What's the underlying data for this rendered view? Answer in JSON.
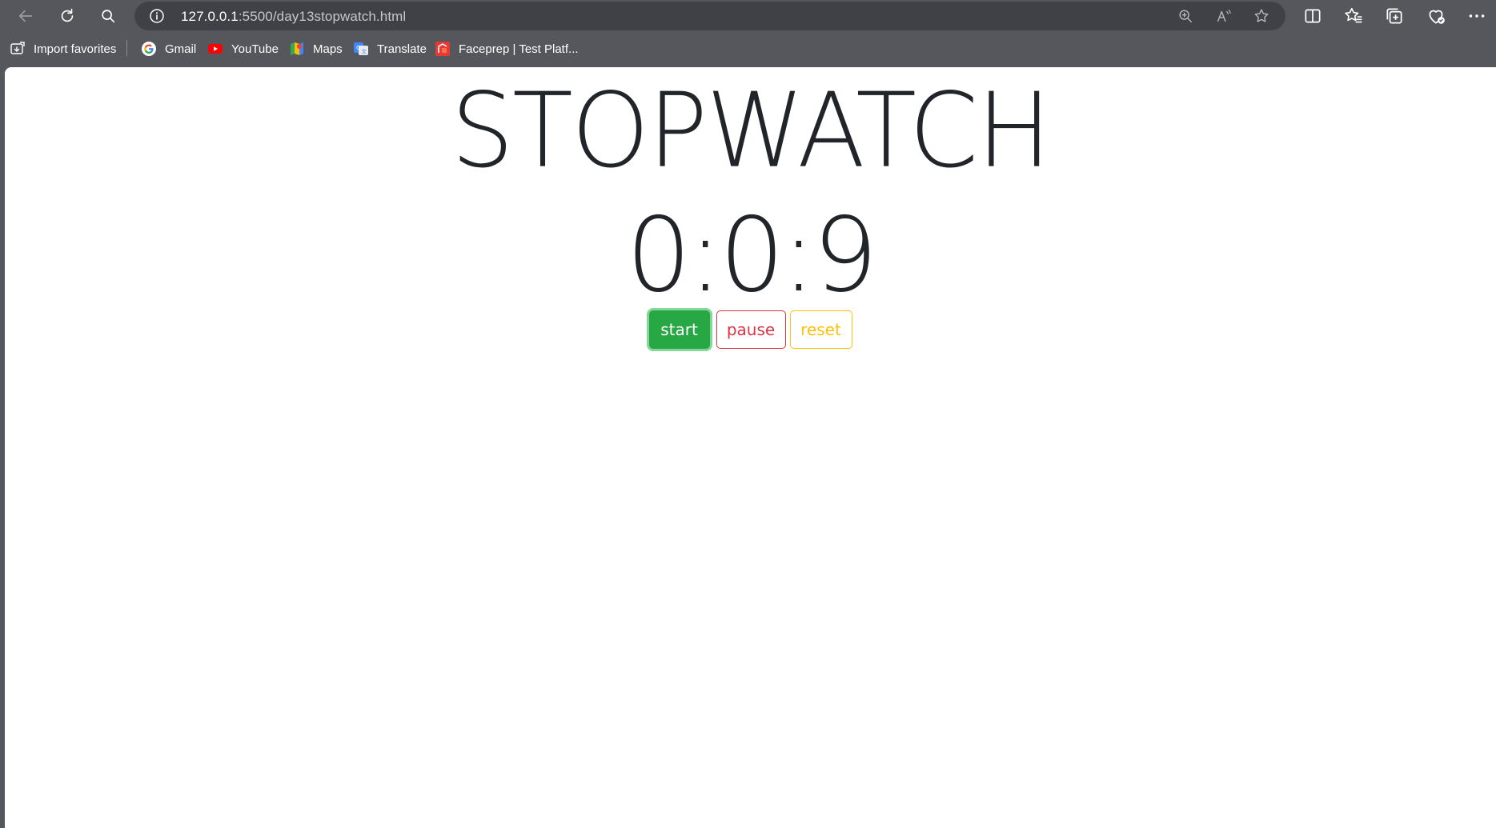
{
  "browser": {
    "address": {
      "host": "127.0.0.1",
      "rest": ":5500/day13stopwatch.html"
    },
    "favorites": [
      {
        "label": "Import favorites",
        "icon": "import-favorites-icon"
      },
      {
        "label": "Gmail",
        "icon": "google-icon"
      },
      {
        "label": "YouTube",
        "icon": "youtube-icon"
      },
      {
        "label": "Maps",
        "icon": "maps-icon"
      },
      {
        "label": "Translate",
        "icon": "translate-icon"
      },
      {
        "label": "Faceprep | Test Platf...",
        "icon": "faceprep-icon"
      }
    ]
  },
  "page": {
    "title": "STOPWATCH",
    "time": "0:0:9",
    "buttons": {
      "start": "start",
      "pause": "pause",
      "reset": "reset"
    }
  },
  "colors": {
    "start": "#28a745",
    "pause": "#dc3545",
    "reset": "#ffc107",
    "text": "#212529",
    "chrome": "#55575c"
  }
}
